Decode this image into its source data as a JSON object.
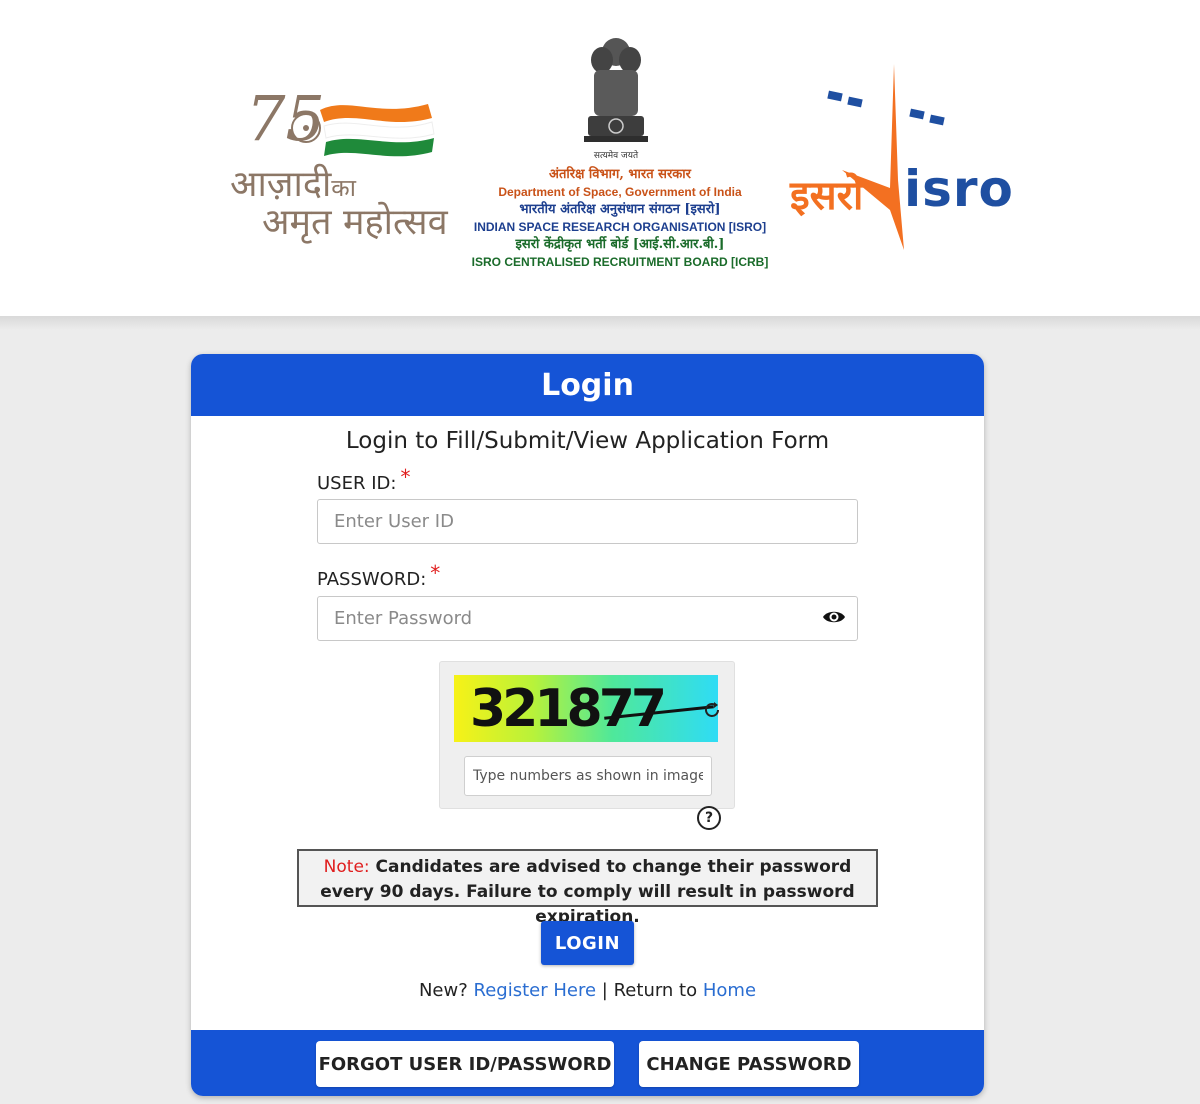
{
  "header": {
    "azadi": {
      "line1": "आज़ादी",
      "line1_small": "का",
      "line2": "अमृत महोत्सव",
      "number": "75"
    },
    "emblem_motto": "सत्यमेव जयते",
    "org_lines": [
      "अंतरिक्ष विभाग, भारत सरकार",
      "Department of Space, Government of India",
      "भारतीय अंतरिक्ष अनुसंधान संगठन [इसरो]",
      "INDIAN SPACE RESEARCH ORGANISATION [ISRO]",
      "इसरो केंद्रीकृत भर्ती बोर्ड [आई.सी.आर.बी.]",
      "ISRO CENTRALISED RECRUITMENT BOARD [ICRB]"
    ],
    "isro_hindi": "इसरो",
    "isro_english": "isro"
  },
  "login": {
    "title": "Login",
    "subtitle": "Login to Fill/Submit/View Application Form",
    "user_id_label": "USER ID:",
    "user_id_placeholder": "Enter User ID",
    "password_label": "PASSWORD:",
    "password_placeholder": "Enter Password",
    "required_mark": "*",
    "captcha_text": "321877",
    "captcha_placeholder": "Type numbers as shown in image",
    "help_symbol": "?",
    "note_label": "Note:",
    "note_text": " Candidates are advised to change their password every 90 days. Failure to comply will result in password expiration.",
    "login_button": "LOGIN",
    "links": {
      "new_text": "New?",
      "register": "Register Here",
      "separator": "|",
      "return_text": "Return to",
      "home": "Home"
    },
    "footer_buttons": {
      "forgot": "FORGOT USER ID/PASSWORD",
      "change": "CHANGE PASSWORD"
    }
  },
  "colors": {
    "primary": "#1554d6",
    "link": "#2a6dd1",
    "required": "#e01e1e",
    "isro_orange": "#f37021",
    "isro_blue": "#1f4fa1"
  },
  "icons": [
    "eye-icon",
    "refresh-icon",
    "help-icon",
    "ashoka-emblem-icon",
    "isro-rocket-icon",
    "tricolor-flag-icon"
  ]
}
